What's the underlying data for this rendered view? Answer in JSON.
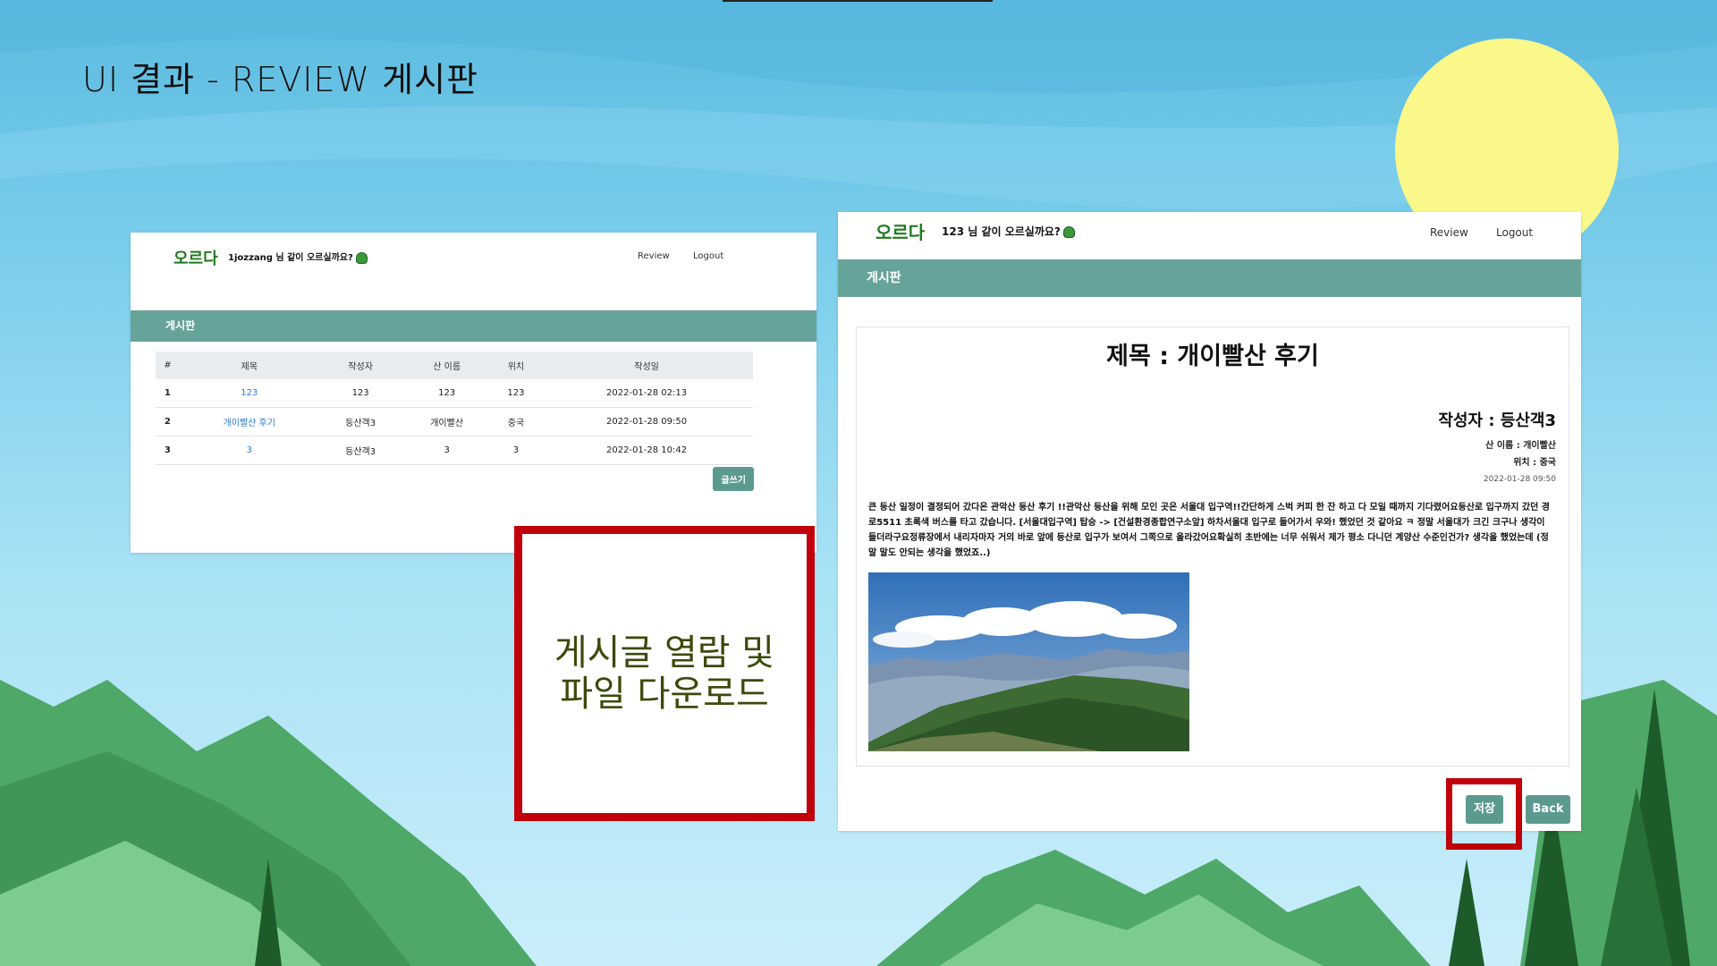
{
  "slide": {
    "title": "UI 결과 -  REVIEW 게시판"
  },
  "list_page": {
    "brand": "오르다",
    "greeting": "1jozzang 님 같이 오르실까요?",
    "nav": {
      "review": "Review",
      "logout": "Logout"
    },
    "band_title": "게시판",
    "table": {
      "headers": [
        "#",
        "제목",
        "작성자",
        "산 이름",
        "위치",
        "작성일"
      ],
      "rows": [
        {
          "num": "1",
          "title": "123",
          "author": "123",
          "mountain": "123",
          "location": "123",
          "date": "2022-01-28 02:13"
        },
        {
          "num": "2",
          "title": "개이빨산 후기",
          "author": "등산객3",
          "mountain": "개이빨산",
          "location": "중국",
          "date": "2022-01-28 09:50"
        },
        {
          "num": "3",
          "title": "3",
          "author": "등산객3",
          "mountain": "3",
          "location": "3",
          "date": "2022-01-28 10:42"
        }
      ]
    },
    "write_button": "글쓰기"
  },
  "callout": {
    "line1": "게시글 열람 및",
    "line2": "파일 다운로드"
  },
  "detail_page": {
    "brand": "오르다",
    "greeting": "123 님 같이 오르실까요?",
    "nav": {
      "review": "Review",
      "logout": "Logout"
    },
    "band_title": "게시판",
    "post": {
      "title": "제목 : 개이빨산 후기",
      "author": "작성자 : 등산객3",
      "mountain": "산 이름 : 개이빨산",
      "location": "위치 : 중국",
      "date": "2022-01-28 09:50",
      "body": "큰 등산 일정이 결정되어 갔다온 관악산 등산 후기 !!관악산 등산을 위해 모인 곳은 서울대 입구역!!간단하게 스벅 커피 한 잔 하고 다 모일 때까지 기다렸어요등산로 입구까지 갔던 경로5511 초록색 버스를 타고 갔습니다. [서울대입구역] 탑승 -> [건설환경종합연구소앞] 하차서울대 입구로 들어가서 우와! 했었던 것 같아요 ㅋ 정말 서울대가 크긴 크구나 생각이 들더라구요정류장에서 내리자마자 거의 바로 앞에 등산로 입구가 보여서 그쪽으로 올라갔어요확실히 초반에는 너무 쉬워서 제가 평소 다니던 계양산 수준인건가? 생각을 했었는데 (정말 말도 안되는 생각을 했었죠..)"
    },
    "buttons": {
      "save": "저장",
      "back": "Back"
    }
  }
}
